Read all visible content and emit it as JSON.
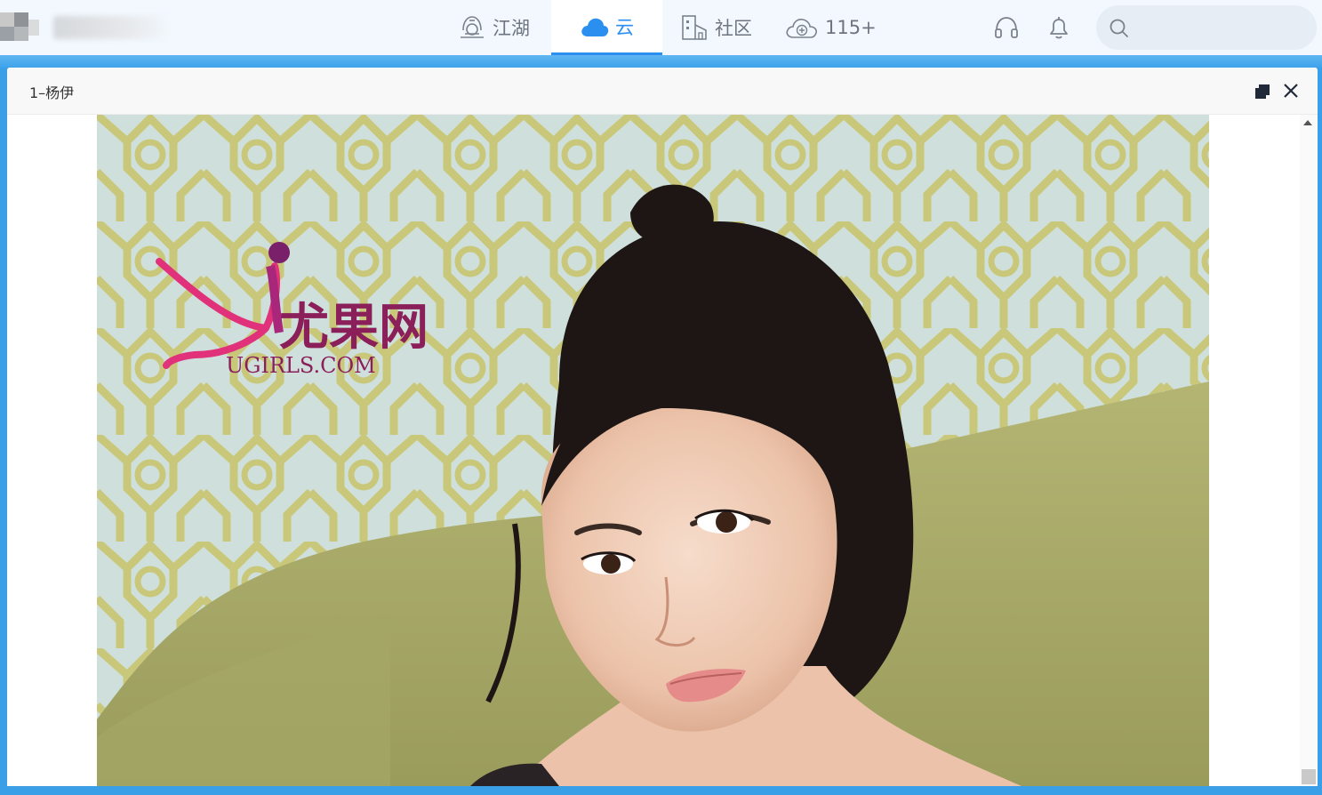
{
  "header": {
    "tabs": [
      {
        "label": "江湖",
        "icon": "jianghu-icon"
      },
      {
        "label": "云",
        "icon": "cloud-icon",
        "active": true
      },
      {
        "label": "社区",
        "icon": "community-icon"
      },
      {
        "label": "115+",
        "icon": "cloud-plus-icon"
      }
    ],
    "search": {
      "placeholder": ""
    },
    "colors": {
      "accent": "#2b8ff0",
      "tab_text": "#6f7580",
      "band": "#3ea3ea"
    }
  },
  "viewer": {
    "title": "1–杨伊",
    "photo": {
      "watermark_text": "UGIRLS.COM",
      "watermark_chinese": "尤果网"
    }
  }
}
